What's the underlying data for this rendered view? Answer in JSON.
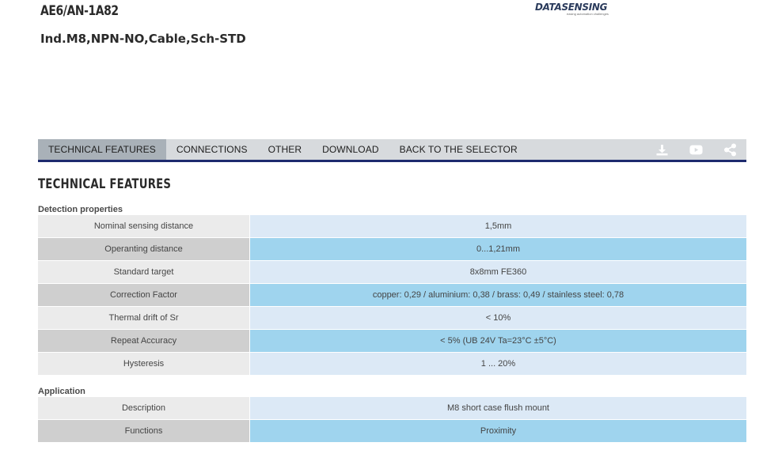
{
  "header": {
    "product_code": "AE6/AN-1A82",
    "product_description": "Ind.M8,NPN-NO,Cable,Sch-STD",
    "logo_text": "DATASENSING",
    "logo_tagline": "easing automation challenges"
  },
  "nav": {
    "tabs": [
      {
        "label": "TECHNICAL FEATURES",
        "active": true
      },
      {
        "label": "CONNECTIONS",
        "active": false
      },
      {
        "label": "OTHER",
        "active": false
      },
      {
        "label": "DOWNLOAD",
        "active": false
      },
      {
        "label": "BACK TO THE SELECTOR",
        "active": false
      }
    ],
    "icons": [
      "download-icon",
      "youtube-icon",
      "share-icon"
    ],
    "active_bg": "#a9b1b8",
    "bar_bg": "#d7dadd",
    "underline_color": "#1d2a6e"
  },
  "section_title": "TECHNICAL FEATURES",
  "groups": [
    {
      "label": "Detection properties",
      "rows": [
        {
          "key": "Nominal sensing distance",
          "value": "1,5mm"
        },
        {
          "key": "Operanting distance",
          "value": "0...1,21mm"
        },
        {
          "key": "Standard target",
          "value": "8x8mm FE360"
        },
        {
          "key": "Correction Factor",
          "value": "copper: 0,29 / aluminium: 0,38 / brass: 0,49 / stainless steel: 0,78"
        },
        {
          "key": "Thermal drift of Sr",
          "value": "< 10%"
        },
        {
          "key": "Repeat Accuracy",
          "value": "< 5% (UB 24V Ta=23°C ±5°C)"
        },
        {
          "key": "Hysteresis",
          "value": "1 ... 20%"
        }
      ]
    },
    {
      "label": "Application",
      "rows": [
        {
          "key": "Description",
          "value": "M8 short case flush mount"
        },
        {
          "key": "Functions",
          "value": "Proximity"
        }
      ]
    }
  ]
}
